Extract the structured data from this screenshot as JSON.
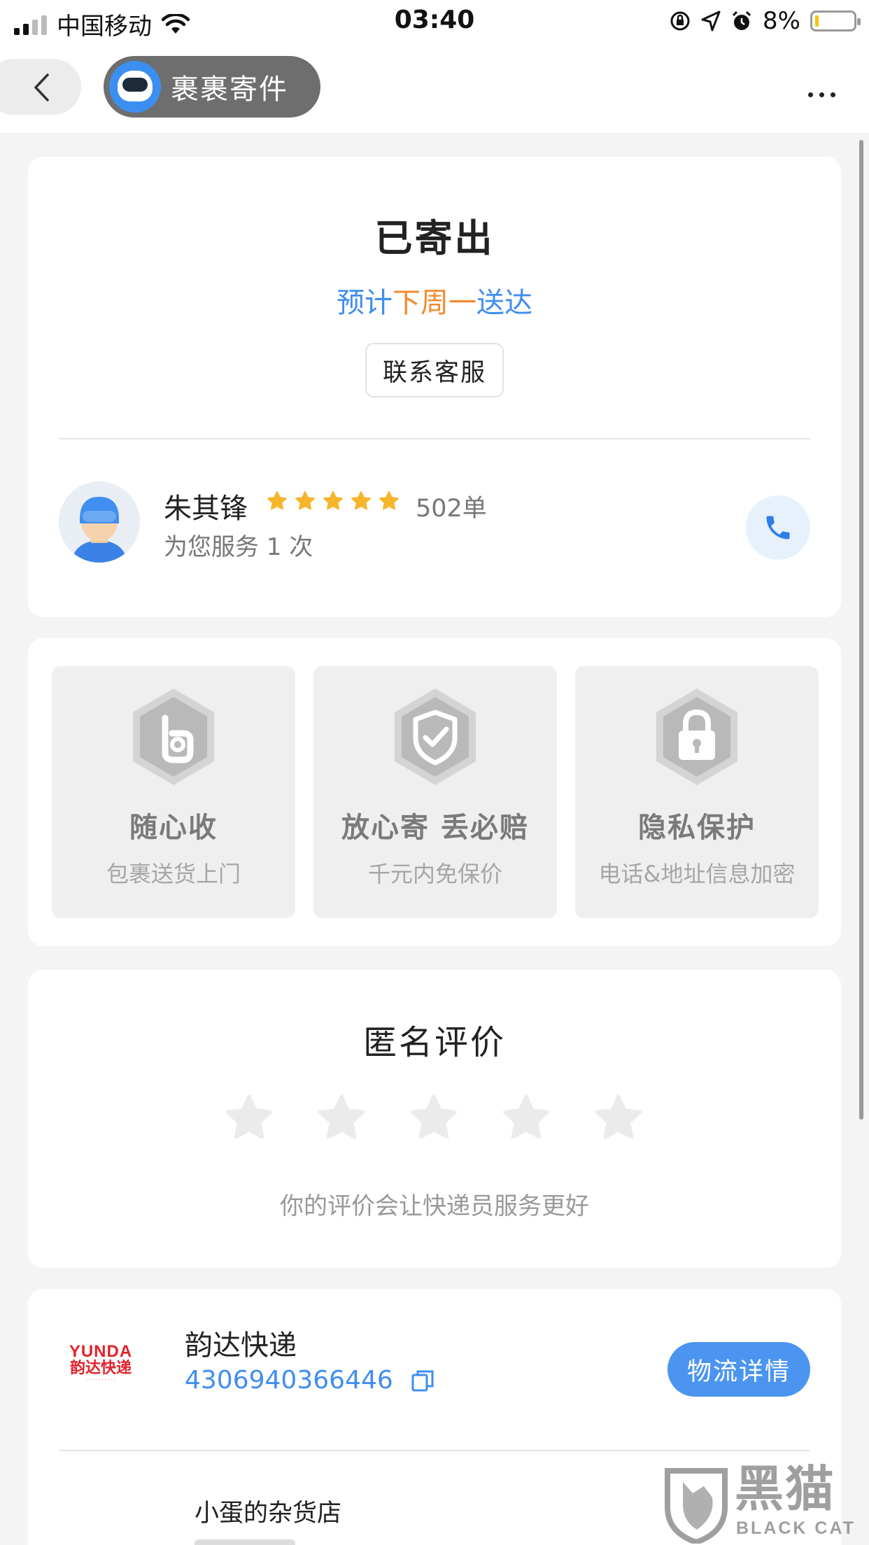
{
  "status_bar": {
    "carrier": "中国移动",
    "time": "03:40",
    "battery": "8%",
    "signal_bars_active": 2,
    "signal_bars_total": 4
  },
  "nav": {
    "app_name": "裹裹寄件",
    "back_icon": "chevron-left-icon",
    "more_icon": "ellipsis-icon"
  },
  "shipment": {
    "status": "已寄出",
    "eta_prefix": "预计",
    "eta_highlight": "下周一",
    "eta_suffix": "送达",
    "contact_button": "联系客服"
  },
  "courier": {
    "name": "朱其锋",
    "rating_stars": 5,
    "orders": "502单",
    "served": "为您服务 1 次",
    "phone_icon": "phone-icon"
  },
  "features": [
    {
      "title": "随心收",
      "subtitle": "包裹送货上门",
      "icon": "ok-hand-icon"
    },
    {
      "title": "放心寄 丢必赔",
      "subtitle": "千元内免保价",
      "icon": "shield-check-icon"
    },
    {
      "title": "隐私保护",
      "subtitle": "电话&地址信息加密",
      "icon": "lock-icon"
    }
  ],
  "rating": {
    "title": "匿名评价",
    "stars_total": 5,
    "stars_selected": 0,
    "hint": "你的评价会让快递员服务更好"
  },
  "logistics": {
    "logo_text": "YUNDA",
    "logo_cn": "韵达快递",
    "carrier": "韵达快递",
    "tracking_number": "4306940366446",
    "copy_icon": "copy-icon",
    "detail_button": "物流详情",
    "shop_name": "小蛋的杂货店"
  },
  "watermark": {
    "cn": "黑猫",
    "en": "BLACK CAT"
  },
  "colors": {
    "accent_blue": "#3f8ef0",
    "highlight_orange": "#f28a2e",
    "star_gold": "#f7b52c",
    "brand_red": "#e3222b"
  }
}
